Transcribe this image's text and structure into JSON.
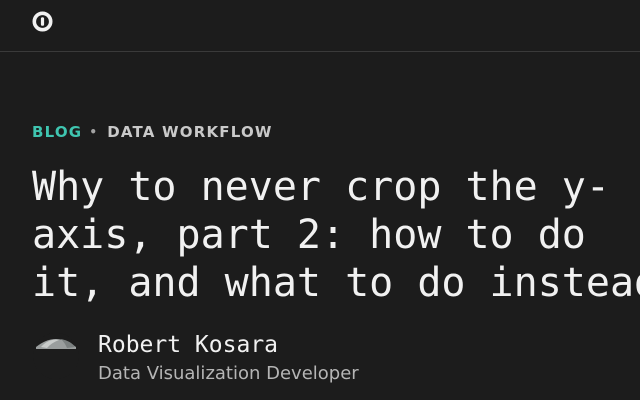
{
  "header": {
    "logo_icon": "circle-logo-icon"
  },
  "article": {
    "category": {
      "section": "BLOG",
      "separator": "•",
      "topic": "DATA WORKFLOW"
    },
    "title_lines": [
      "Why to never crop the y-",
      "axis, part 2: how to do",
      "it, and what to do instead"
    ]
  },
  "author": {
    "name": "Robert Kosara",
    "role": "Data Visualization Developer",
    "avatar_icon": "author-photo"
  },
  "colors": {
    "background": "#1c1c1c",
    "accent": "#3fc5b0",
    "text": "#f1f1f1",
    "muted": "#b5b5b5"
  }
}
